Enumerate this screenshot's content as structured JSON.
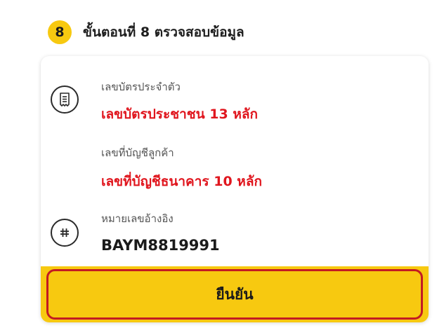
{
  "step": {
    "number": "8",
    "title": "ขั้นตอนที่ 8 ตรวจสอบข้อมูล"
  },
  "fields": [
    {
      "label": "เลขบัตรประจำตัว",
      "value": "เลขบัตรประชาชน 13 หลัก",
      "icon": "receipt-icon"
    },
    {
      "label": "เลขที่บัญชีลูกค้า",
      "value": "เลขที่บัญชีธนาคาร 10 หลัก",
      "icon": ""
    },
    {
      "label": "หมายเลขอ้างอิง",
      "value": "BAYM8819991",
      "icon": "hash-icon"
    }
  ],
  "button": {
    "confirm_label": "ยืนยัน"
  },
  "colors": {
    "accent": "#f7c910",
    "highlight_text": "#e0161e",
    "button_outline": "#c31b22"
  }
}
